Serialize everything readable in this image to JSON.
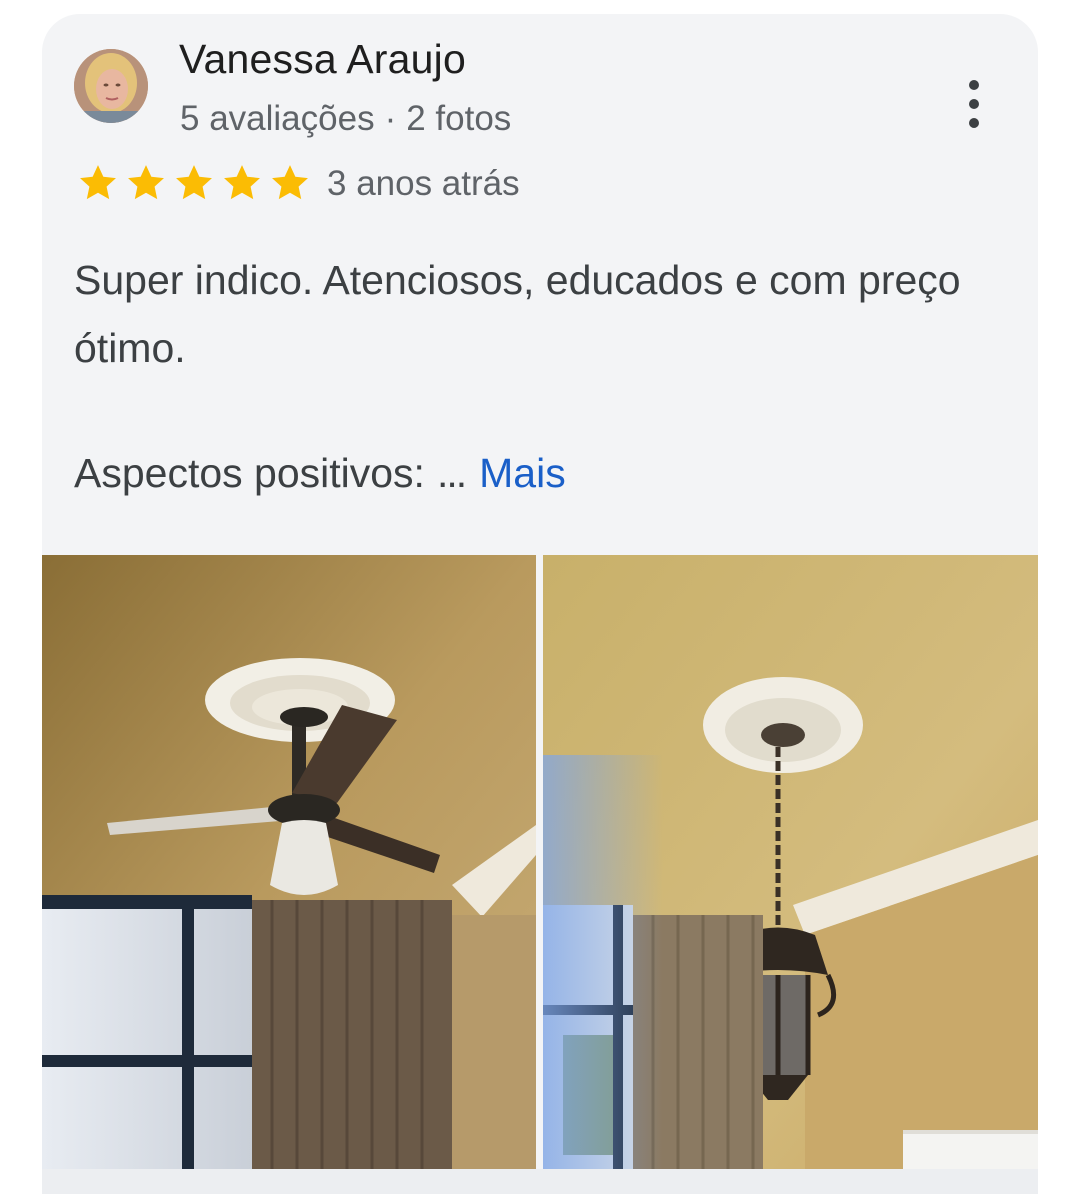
{
  "review": {
    "author_name": "Vanessa Araujo",
    "reviews_count": "5 avaliações",
    "separator": "·",
    "photos_count": "2 fotos",
    "rating": 5,
    "rating_max": 5,
    "time_ago": "3 anos atrás",
    "text": "Super indico. Atenciosos, educados e com preço ótimo.",
    "aspects_label": "Aspectos positivos:",
    "ellipsis": "...",
    "more_label": "Mais"
  },
  "icons": {
    "menu": "more-vert-icon",
    "star": "star-icon"
  },
  "photos": [
    {
      "subject": "ceiling-fan-photo"
    },
    {
      "subject": "pendant-lantern-photo"
    }
  ],
  "colors": {
    "star": "#fbbc04",
    "link": "#1a5fc8",
    "card_bg": "#f3f4f6",
    "primary_text": "#1f1f1f",
    "secondary_text": "#5f6368"
  }
}
